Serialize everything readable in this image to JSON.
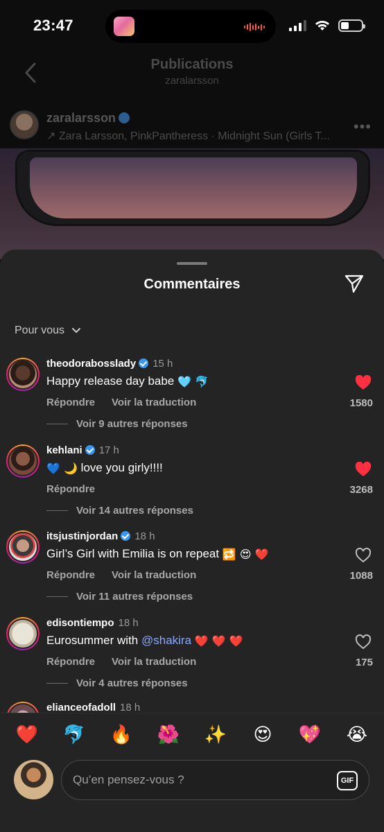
{
  "status": {
    "time": "23:47"
  },
  "nav": {
    "title": "Publications",
    "subtitle": "zaralarsson"
  },
  "post": {
    "username": "zaralarsson",
    "music": "Zara Larsson, PinkPantheress · Midnight Sun (Girls T...",
    "more": "•••"
  },
  "sheet": {
    "title": "Commentaires",
    "sort_label": "Pour vous"
  },
  "comments": [
    {
      "username": "theodorabosslady",
      "time": "15 h",
      "text": "Happy release day babe",
      "text_emoji": "🩵 🐬",
      "reply": "Répondre",
      "translate": "Voir la traduction",
      "likes": "1580",
      "liked": true,
      "replies": "Voir 9 autres réponses"
    },
    {
      "username": "kehlani",
      "time": "17 h",
      "text_emoji_pre": "💙 🌙",
      "text": "love you girly!!!!",
      "reply": "Répondre",
      "likes": "3268",
      "liked": true,
      "replies": "Voir 14 autres réponses"
    },
    {
      "username": "itsjustinjordan",
      "time": "18 h",
      "text": "Girl’s Girl with Emilia is on repeat",
      "text_emoji": "🔁 😍 ❤️",
      "reply": "Répondre",
      "translate": "Voir la traduction",
      "likes": "1088",
      "liked": false,
      "replies": "Voir 11 autres réponses"
    },
    {
      "username": "edisontiempo",
      "time": "18 h",
      "text": "Eurosummer with",
      "mention": "@shakira",
      "text_emoji": "❤️ ❤️ ❤️",
      "reply": "Répondre",
      "translate": "Voir la traduction",
      "likes": "175",
      "liked": false,
      "replies": "Voir 4 autres réponses"
    },
    {
      "username": "elianceofadoll",
      "time": "18 h"
    }
  ],
  "reactions": [
    "❤️",
    "🐬",
    "🔥",
    "🌺",
    "✨",
    "😍",
    "💖",
    "😭"
  ],
  "composer": {
    "placeholder": "Qu’en pensez-vous ?",
    "gif_label": "GIF"
  },
  "colors": {
    "like_active": "#ff3040",
    "accent_blue": "#3897f0",
    "mention": "#8aa8ff"
  }
}
